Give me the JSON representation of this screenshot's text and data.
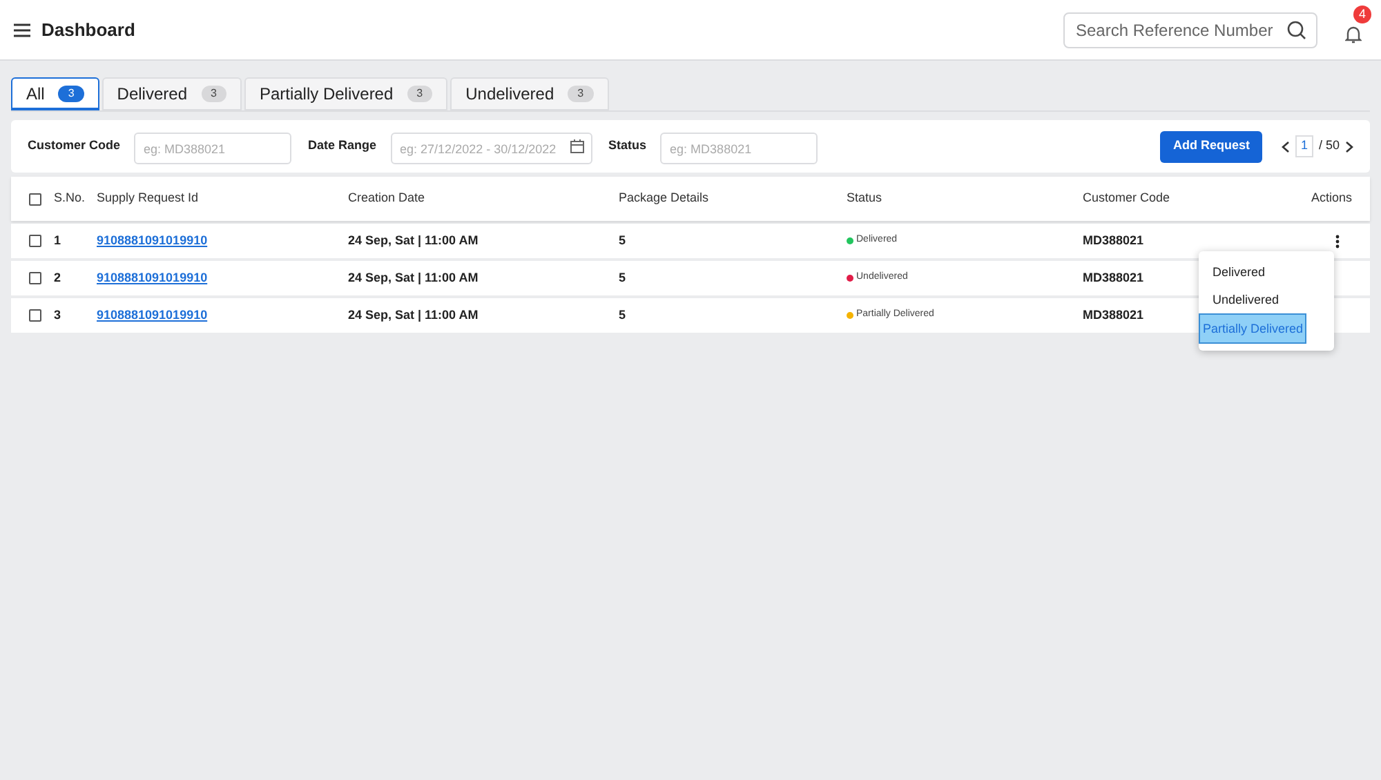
{
  "header": {
    "title": "Dashboard",
    "search": {
      "placeholder": "Search Reference Number"
    },
    "notifications": "4"
  },
  "tabs": [
    {
      "label": "All",
      "count": "3",
      "selected": true
    },
    {
      "label": "Delivered",
      "count": "3",
      "selected": false
    },
    {
      "label": "Partially Delivered",
      "count": "3",
      "selected": false
    },
    {
      "label": "Undelivered",
      "count": "3",
      "selected": false
    }
  ],
  "filters": [
    {
      "label": "Customer Code",
      "placeholder": "eg: MD388021",
      "kind": "text"
    },
    {
      "label": "Date Range",
      "placeholder": "eg: 27/12/2022 - 30/12/2022",
      "kind": "date"
    },
    {
      "label": "Status",
      "placeholder": "eg: MD388021",
      "kind": "text"
    }
  ],
  "add_button": "Add Request",
  "pagination": {
    "page": "1",
    "total": "/ 50"
  },
  "table": {
    "all_checked": false,
    "columns": [
      "S.No.",
      "Supply Request Id",
      "Creation Date",
      "Package Details",
      "Status",
      "Customer Code",
      "Actions"
    ],
    "rows": [
      {
        "checked": false,
        "sno": "1",
        "id": "9108881091019910",
        "date": "24 Sep, Sat | 11:00 AM",
        "packages": "5",
        "status": "Delivered",
        "color": "#22c55e",
        "customer": "MD388021",
        "menu_open": true
      },
      {
        "checked": false,
        "sno": "2",
        "id": "9108881091019910",
        "date": "24 Sep, Sat | 11:00 AM",
        "packages": "5",
        "status": "Undelivered",
        "color": "#e11d48",
        "customer": "MD388021",
        "menu_open": false
      },
      {
        "checked": false,
        "sno": "3",
        "id": "9108881091019910",
        "date": "24 Sep, Sat | 11:00 AM",
        "packages": "5",
        "status": "Partially Delivered",
        "color": "#f5b300",
        "customer": "MD388021",
        "menu_open": false
      }
    ]
  },
  "action_menu": [
    {
      "label": "Delivered",
      "selected": false
    },
    {
      "label": "Undelivered",
      "selected": false
    },
    {
      "label": "Partially Delivered",
      "selected": true
    }
  ]
}
